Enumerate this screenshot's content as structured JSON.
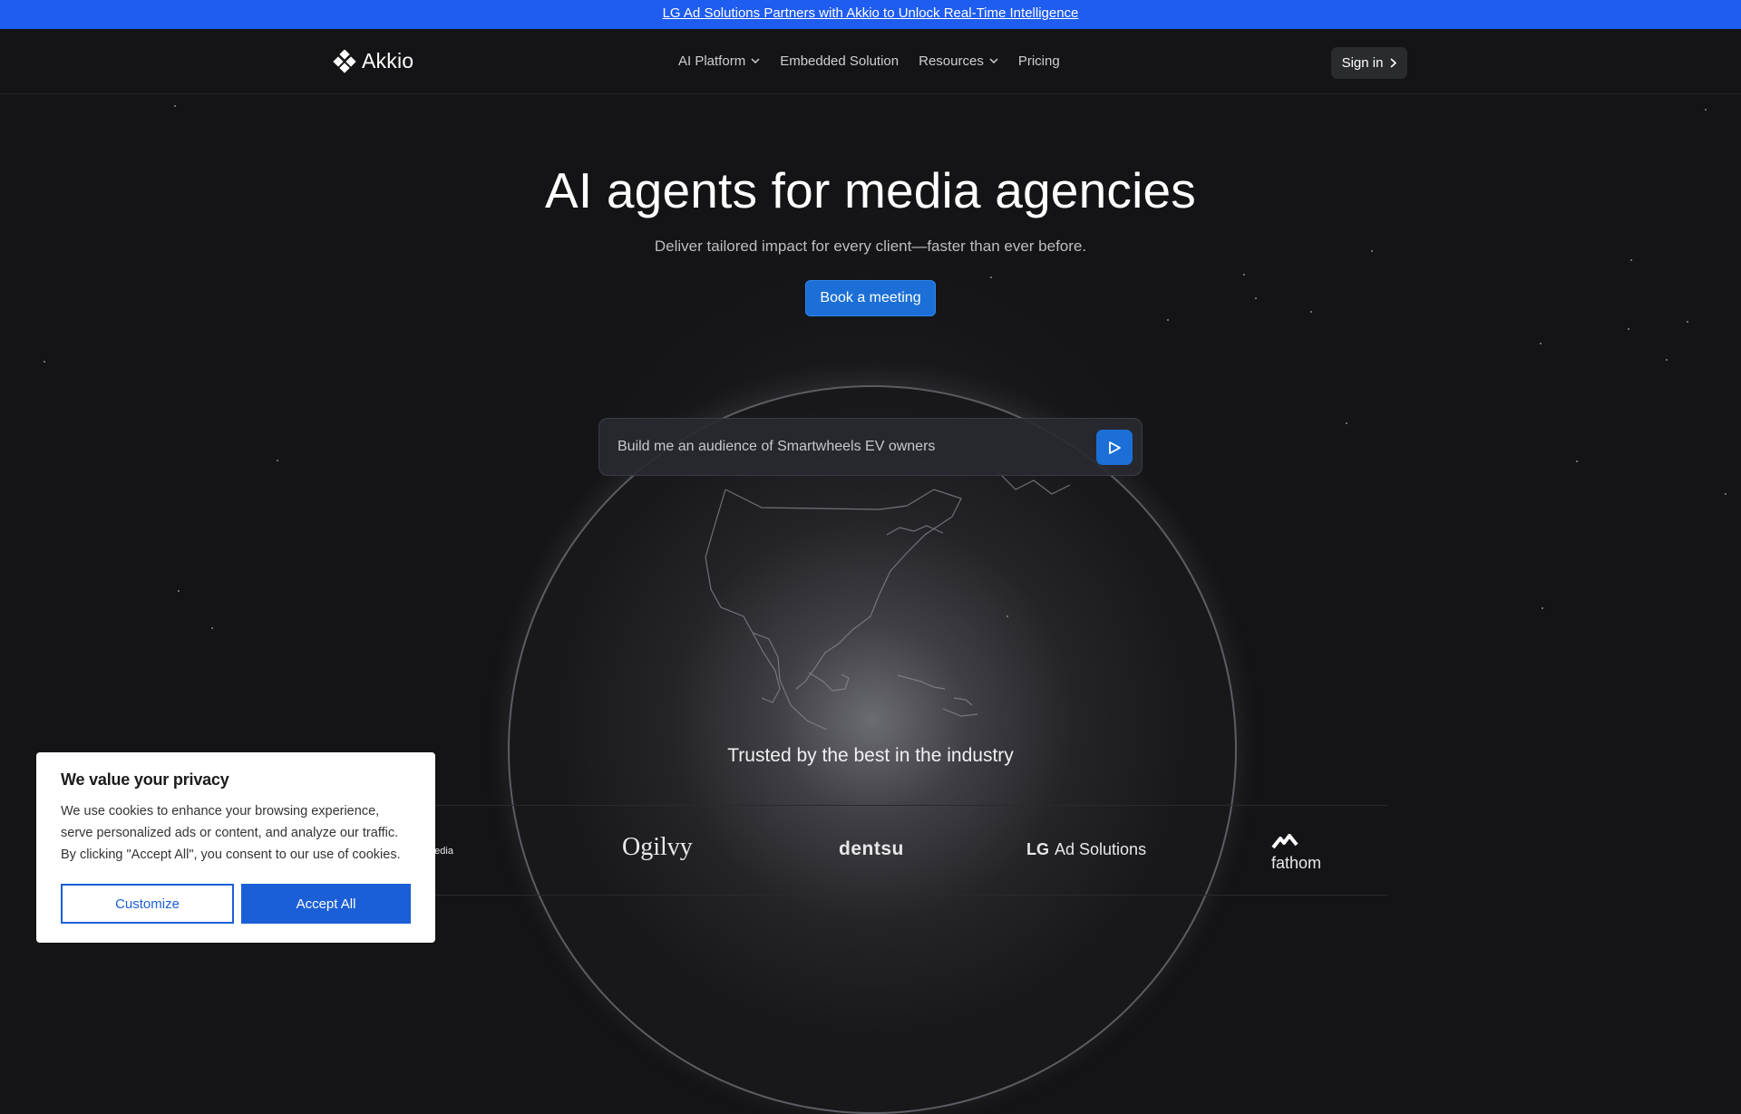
{
  "banner": {
    "text": "LG Ad Solutions Partners with Akkio to Unlock Real-Time Intelligence"
  },
  "nav": {
    "logo_text": "Akkio",
    "items": [
      {
        "label": "AI Platform",
        "has_dropdown": true
      },
      {
        "label": "Embedded Solution",
        "has_dropdown": false
      },
      {
        "label": "Resources",
        "has_dropdown": true
      },
      {
        "label": "Pricing",
        "has_dropdown": false
      }
    ],
    "signin_label": "Sign in"
  },
  "hero": {
    "title": "AI agents for media agencies",
    "subtitle": "Deliver tailored impact for every client—faster than ever before.",
    "cta_label": "Book a meeting"
  },
  "prompt": {
    "text": "Build me an audience of Smartwheels EV owners"
  },
  "trusted": {
    "heading": "Trusted by the best in the industry",
    "logos": [
      {
        "name": "media",
        "text": "media"
      },
      {
        "name": "ogilvy",
        "text": "Ogilvy"
      },
      {
        "name": "dentsu",
        "text": "dentsu"
      },
      {
        "name": "lg-ad-solutions",
        "text_lg": "LG",
        "text_rest": "Ad Solutions"
      },
      {
        "name": "fathom",
        "text": "fathom"
      }
    ]
  },
  "cookie": {
    "title": "We value your privacy",
    "body": "We use cookies to enhance your browsing experience, serve personalized ads or content, and analyze our traffic. By clicking \"Accept All\", you consent to our use of cookies.",
    "customize_label": "Customize",
    "accept_label": "Accept All"
  },
  "colors": {
    "banner": "#1f5cf0",
    "background": "#141416",
    "accent": "#1b6fd6",
    "cookie_accent": "#1b5fd6"
  }
}
